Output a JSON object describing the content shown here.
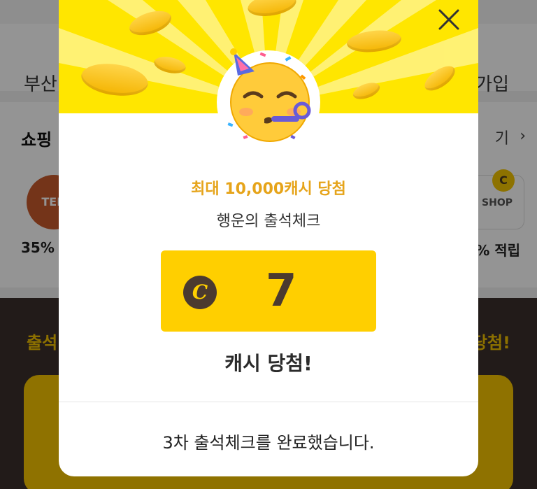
{
  "background": {
    "header_left": "부산",
    "header_right": "가입",
    "section_title": "쇼핑",
    "section_more": "기",
    "logo_left": "TEN",
    "logo_right": "SHOP",
    "coin_badge": "C",
    "percent_left": "35%",
    "percent_right": "% 적립",
    "dark_left": "출석",
    "dark_right": "당첨!",
    "colors": {
      "dark_bg": "#3b2f2c",
      "accent_yellow": "#f2c200"
    }
  },
  "modal": {
    "close_icon": "close-icon",
    "emoji_icon": "party-face-emoji",
    "headline": "최대 10,000캐시 당첨",
    "subtitle": "행운의 출석체크",
    "reward": {
      "coin_symbol": "C",
      "value": "7"
    },
    "result_text": "캐시 당첨!",
    "footer_text": "3차 출석체크를 완료했습니다.",
    "colors": {
      "top_banner": "#ffe600",
      "reward_box": "#ffcf00",
      "headline": "#e6a41a",
      "coin_dark": "#4b3a2f"
    }
  }
}
